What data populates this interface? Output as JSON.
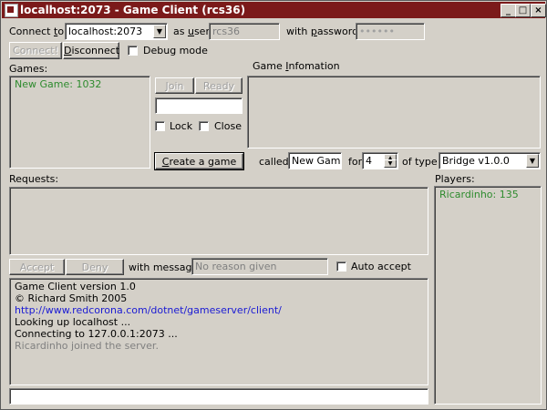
{
  "window": {
    "title": "localhost:2073 - Game Client (rcs36)",
    "controls": {
      "minimize": "_",
      "maximize": "□",
      "close": "×"
    }
  },
  "connect": {
    "label_pre": "Connect ",
    "label_key": "t",
    "label_post": "o:",
    "host_value": "localhost:2073",
    "as_user_pre": "as ",
    "as_user_key": "u",
    "as_user_post": "ser",
    "user_value": "rcs36",
    "password_pre": "with ",
    "password_key": "p",
    "password_post": "assword",
    "password_value": "••••••",
    "connect_button": "Connect!",
    "disconnect_pre": "",
    "disconnect_key": "D",
    "disconnect_post": "isconnect",
    "debug_label": "Debug mode"
  },
  "games": {
    "label": "Games:",
    "items": [
      {
        "text": "New Game: 1032",
        "color": "#2e8b2e"
      }
    ],
    "join_button": "Join",
    "ready_button": "Ready",
    "name_value": "",
    "lock_label": "Lock",
    "close_label": "Close",
    "create_pre": "",
    "create_key": "C",
    "create_post": "reate a game",
    "called_label": "called",
    "called_value": "New Game",
    "for_label": "for",
    "for_value": "4",
    "of_type_label": "of type",
    "type_value": "Bridge v1.0.0"
  },
  "game_info": {
    "label_pre": "Game ",
    "label_key": "I",
    "label_post": "nfomation"
  },
  "requests": {
    "label": "Requests:",
    "accept_button": "Accept",
    "deny_button": "Deny",
    "message_label": "with message",
    "message_placeholder": "No reason given",
    "auto_accept_label": "Auto accept"
  },
  "players": {
    "label": "Players:",
    "items": [
      {
        "text": "Ricardinho: 135",
        "color": "#2e8b2e"
      }
    ]
  },
  "log": {
    "lines": [
      {
        "text": "Game Client version 1.0",
        "color": "#000000"
      },
      {
        "text": "© Richard Smith 2005",
        "color": "#000000"
      },
      {
        "text": "http://www.redcorona.com/dotnet/gameserver/client/",
        "color": "#1a1ad4"
      },
      {
        "text": "Looking up localhost ...",
        "color": "#000000"
      },
      {
        "text": "Connecting to 127.0.0.1:2073 ...",
        "color": "#000000"
      },
      {
        "text": "Ricardinho joined the server.",
        "color": "#808080"
      }
    ]
  },
  "chat": {
    "input_value": ""
  }
}
